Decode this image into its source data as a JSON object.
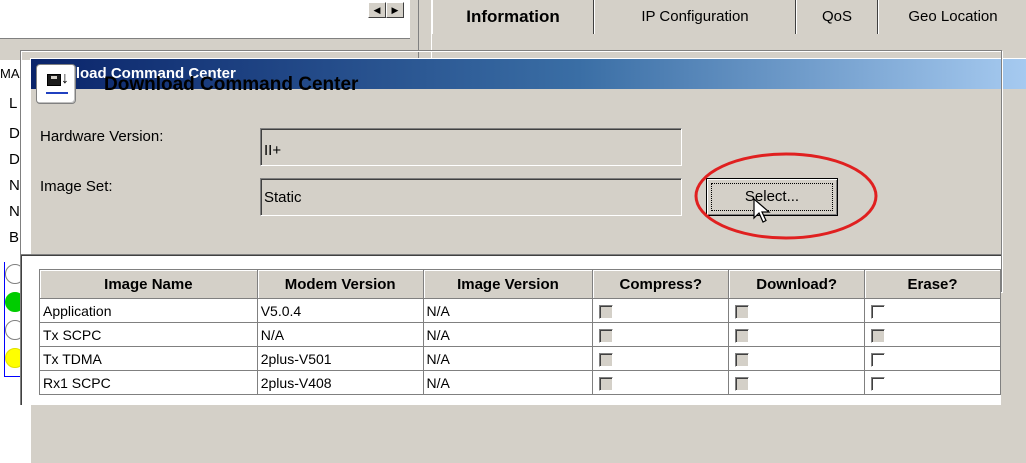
{
  "background": {
    "tabs": [
      {
        "label": "Information",
        "active": true
      },
      {
        "label": "IP Configuration",
        "active": false
      },
      {
        "label": "QoS",
        "active": false
      },
      {
        "label": "Geo Location",
        "active": false
      }
    ],
    "sidebar_letters": [
      "MA",
      "L",
      "D",
      "D",
      "N",
      "N",
      "B"
    ],
    "status_colors": [
      "#ffffff",
      "#00cc00",
      "#ffffff",
      "#ffff00"
    ]
  },
  "dialog": {
    "title": "Download Command Center",
    "header_title": "Download Command Center",
    "header_icon": "floppy-download-icon",
    "hardware_version_label": "Hardware Version:",
    "hardware_version_value": "II+",
    "image_set_label": "Image Set:",
    "image_set_value": "Static",
    "select_button_label": "Select...",
    "highlight_color": "#e02020"
  },
  "table": {
    "columns": [
      "Image Name",
      "Modem Version",
      "Image Version",
      "Compress?",
      "Download?",
      "Erase?"
    ],
    "rows": [
      {
        "image_name": "Application",
        "modem_version": "V5.0.4",
        "image_version": "N/A",
        "compress": false,
        "download": false,
        "erase": false,
        "erase_enabled": true
      },
      {
        "image_name": "Tx SCPC",
        "modem_version": "N/A",
        "image_version": "N/A",
        "compress": false,
        "download": false,
        "erase": false,
        "erase_enabled": false
      },
      {
        "image_name": "Tx TDMA",
        "modem_version": "2plus-V501",
        "image_version": "N/A",
        "compress": false,
        "download": false,
        "erase": false,
        "erase_enabled": true
      },
      {
        "image_name": "Rx1 SCPC",
        "modem_version": "2plus-V408",
        "image_version": "N/A",
        "compress": false,
        "download": false,
        "erase": false,
        "erase_enabled": true
      }
    ]
  }
}
